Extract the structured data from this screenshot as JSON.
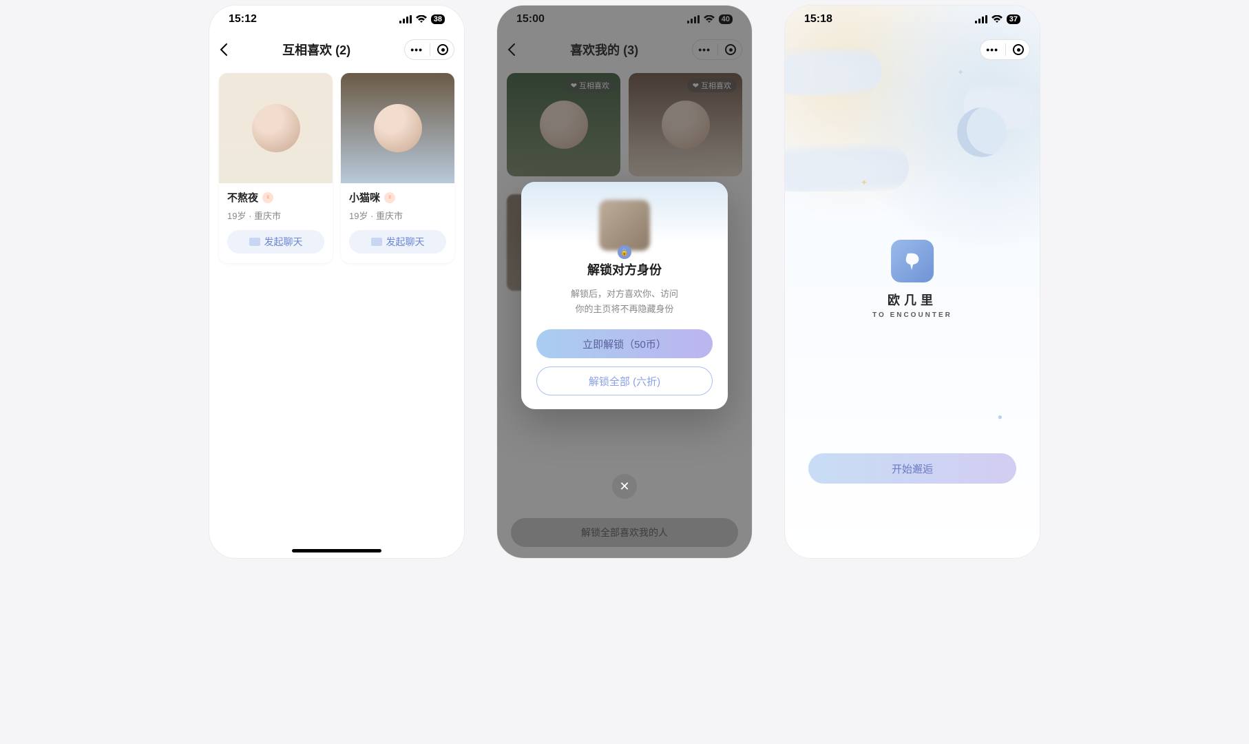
{
  "screens": [
    {
      "status": {
        "time": "15:12",
        "battery": "38"
      },
      "nav": {
        "title": "互相喜欢 (2)"
      },
      "users": [
        {
          "name": "不熬夜",
          "age": "19岁",
          "city": "重庆市",
          "chat": "发起聊天"
        },
        {
          "name": "小猫咪",
          "age": "19岁",
          "city": "重庆市",
          "chat": "发起聊天"
        }
      ]
    },
    {
      "status": {
        "time": "15:00",
        "battery": "40"
      },
      "nav": {
        "title": "喜欢我的 (3)"
      },
      "bg": {
        "mutual_label": "互相喜欢"
      },
      "modal": {
        "title": "解锁对方身份",
        "desc1": "解锁后，对方喜欢你、访问",
        "desc2": "你的主页将不再隐藏身份",
        "primary": "立即解锁（50币）",
        "outline": "解锁全部 (六折)"
      },
      "bottom": "解锁全部喜欢我的人"
    },
    {
      "status": {
        "time": "15:18",
        "battery": "37"
      },
      "brand": {
        "cn": "欧几里",
        "en": "TO ENCOUNTER"
      },
      "start": "开始邂逅"
    }
  ]
}
